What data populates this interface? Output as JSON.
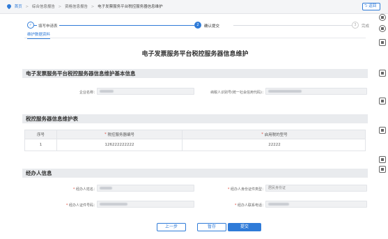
{
  "breadcrumb": {
    "home": "首页",
    "items": [
      "综合信息报告",
      "资格信息报告",
      "电子发票服务平台税控服务器信息维护"
    ]
  },
  "back_label": "返回",
  "steps": [
    {
      "label": "填写申请表",
      "state": "done",
      "num": "✓"
    },
    {
      "label": "确认提交",
      "state": "active",
      "num": "2"
    },
    {
      "label": "完成",
      "state": "pending",
      "num": "3"
    }
  ],
  "tab": {
    "label": "维护数据资料"
  },
  "page_title": "电子发票服务平台税控服务器信息维护",
  "basic_info": {
    "title": "电子发票服务平台税控服务器信息维护基本信息",
    "company_label": "企业名称：",
    "taxid_label": "纳税人识别号(统一社会信用代码)："
  },
  "table": {
    "title": "税控服务器信息维护表",
    "headers": [
      "序号",
      "税控服务器编号",
      "启用税的型号"
    ],
    "rows": [
      {
        "seq": "1",
        "server_no": "126222222222",
        "model": "22222"
      }
    ]
  },
  "handler": {
    "title": "经办人信息",
    "name_label": "经办人姓名：",
    "id_type_label": "经办人身份证件类型：",
    "id_type_value": "居民身份证",
    "id_no_label": "经办人证件号码：",
    "phone_label": "经办人联系电话："
  },
  "buttons": {
    "prev": "上一步",
    "save": "暂存",
    "submit": "提交"
  },
  "colors": {
    "accent": "#2f7bd8",
    "required": "#e04a3c"
  }
}
